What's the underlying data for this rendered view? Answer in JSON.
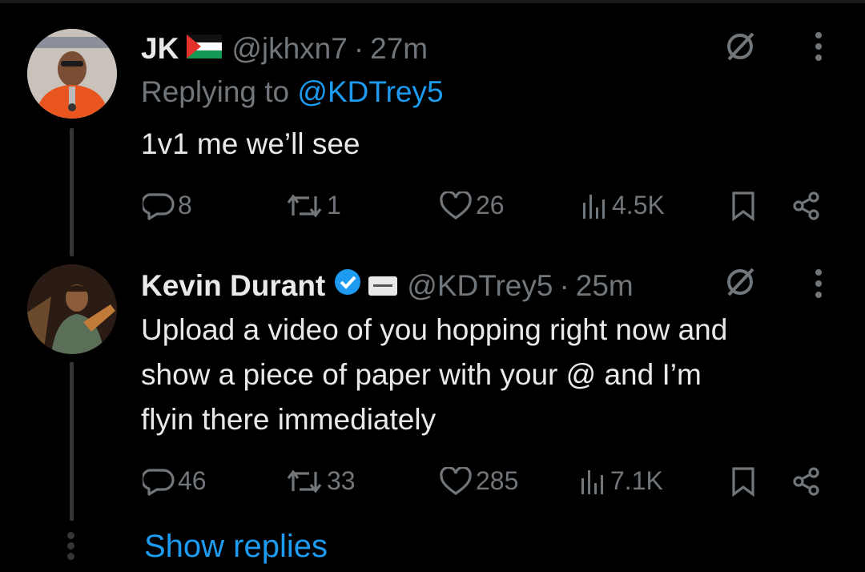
{
  "colors": {
    "background": "#000000",
    "text": "#e7e9ea",
    "muted": "#71767b",
    "link": "#1d9bf0"
  },
  "tweet1": {
    "name": "JK",
    "handle": "@jkhxn7",
    "separator": "·",
    "time": "27m",
    "replying_prefix": "Replying to ",
    "replying_handle": "@KDTrey5",
    "text": "1v1 me we’ll see",
    "stats": {
      "replies": "8",
      "reposts": "1",
      "likes": "26",
      "views": "4.5K"
    }
  },
  "tweet2": {
    "name": "Kevin Durant",
    "handle": "@KDTrey5",
    "separator": "·",
    "time": "25m",
    "text_lines": [
      "Upload a video of you hopping right now and",
      "show a piece of paper with your @ and I’m",
      "flyin there immediately"
    ],
    "stats": {
      "replies": "46",
      "reposts": "33",
      "likes": "285",
      "views": "7.1K"
    }
  },
  "show_replies": "Show replies",
  "icons": [
    "reply-icon",
    "repost-icon",
    "like-icon",
    "views-icon",
    "bookmark-icon",
    "share-icon",
    "grok-icon",
    "more-icon",
    "verified-badge-icon",
    "palestine-flag-icon"
  ]
}
